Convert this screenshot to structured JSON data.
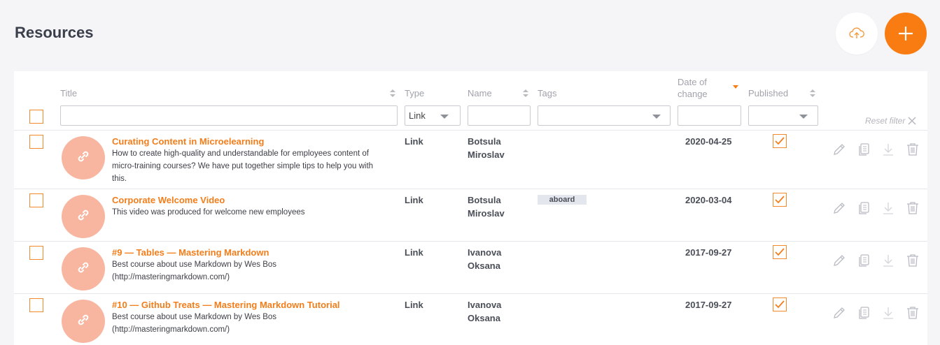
{
  "page": {
    "title": "Resources"
  },
  "toolbar": {
    "upload_icon": "cloud-upload-icon",
    "add_icon": "plus-icon"
  },
  "table": {
    "headers": {
      "title": "Title",
      "type": "Type",
      "name": "Name",
      "tags": "Tags",
      "date_line1": "Date of",
      "date_line2": "change",
      "published": "Published"
    },
    "filters": {
      "title_value": "",
      "type_value": "Link",
      "name_value": "",
      "tags_value": "",
      "date_value": "",
      "published_value": "",
      "reset_label": "Reset filter"
    },
    "rows": [
      {
        "title": "Curating Content in Microelearning",
        "desc_lines": [
          "How to create high-quality and understandable for employees content of",
          "micro-training courses? We have put together simple tips to help you with",
          "this."
        ],
        "type": "Link",
        "name_first": "Botsula",
        "name_last": "Miroslav",
        "tag": "",
        "date": "2020-04-25",
        "published": true
      },
      {
        "title": "Corporate Welcome Video",
        "desc_lines": [
          "This video was produced for welcome new employees",
          "",
          ""
        ],
        "type": "Link",
        "name_first": "Botsula",
        "name_last": "Miroslav",
        "tag": "aboard",
        "date": "2020-03-04",
        "published": true
      },
      {
        "title": "#9 — Tables — Mastering Markdown",
        "desc_lines": [
          "Best course about use Markdown by Wes Bos",
          "(http://masteringmarkdown.com/)",
          ""
        ],
        "type": "Link",
        "name_first": "Ivanova",
        "name_last": "Oksana",
        "tag": "",
        "date": "2017-09-27",
        "published": true
      },
      {
        "title": "#10 — Github Treats — Mastering Markdown Tutorial",
        "desc_lines": [
          "Best course about use Markdown by Wes Bos",
          "(http://masteringmarkdown.com/)",
          ""
        ],
        "type": "Link",
        "name_first": "Ivanova",
        "name_last": "Oksana",
        "tag": "",
        "date": "2017-09-27",
        "published": true
      }
    ]
  },
  "colors": {
    "accent": "#f97c12",
    "avatar": "#f8b6a0",
    "icon_muted": "#b9bcc4"
  }
}
